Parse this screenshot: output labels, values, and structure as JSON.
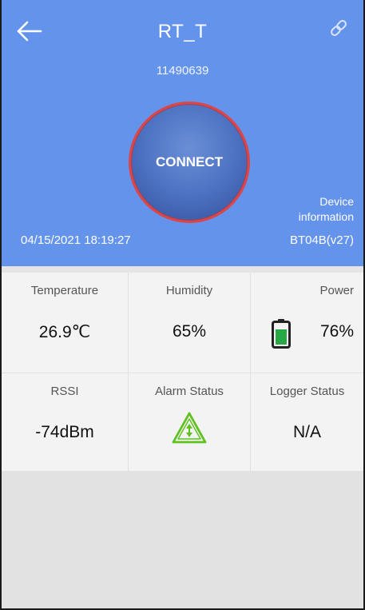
{
  "header": {
    "title": "RT_T",
    "serial": "11490639",
    "connect_label": "CONNECT",
    "device_info_line1": "Device",
    "device_info_line2": "information",
    "datetime": "04/15/2021 18:19:27",
    "firmware": "BT04B(v27)",
    "back_icon": "arrow-left-icon",
    "link_icon": "link-icon",
    "bg_color": "#6493ec",
    "connect_ring_color": "#d9474b"
  },
  "status": {
    "temperature": {
      "label": "Temperature",
      "value": "26.9℃"
    },
    "humidity": {
      "label": "Humidity",
      "value": "65%"
    },
    "power": {
      "label": "Power",
      "value": "76%",
      "battery_level": 0.76,
      "icon": "battery-icon",
      "battery_color": "#28a745"
    },
    "rssi": {
      "label": "RSSI",
      "value": "-74dBm"
    },
    "alarm": {
      "label": "Alarm Status",
      "icon": "alarm-triangle-icon",
      "icon_color": "#5ec21d"
    },
    "logger": {
      "label": "Logger Status",
      "value": "N/A"
    }
  }
}
